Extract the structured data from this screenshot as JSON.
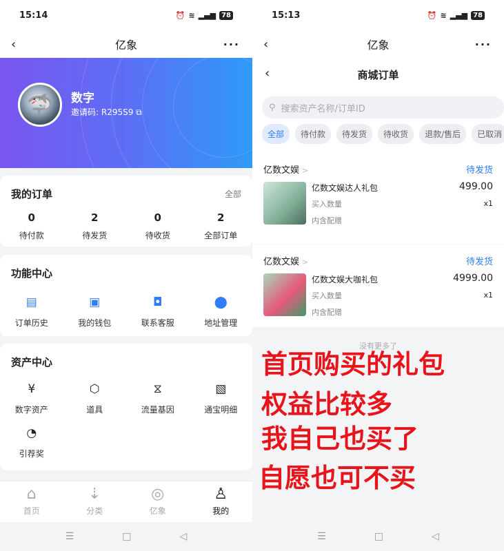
{
  "left": {
    "status": {
      "time": "15:14",
      "battery": "78"
    },
    "nav": {
      "title": "亿象",
      "back": "‹",
      "more": "···"
    },
    "profile": {
      "name": "数字",
      "invite": "邀请码: R295S9 ⧉"
    },
    "orders": {
      "title": "我的订单",
      "link": "全部",
      "items": [
        {
          "count": "0",
          "label": "待付款"
        },
        {
          "count": "2",
          "label": "待发货"
        },
        {
          "count": "0",
          "label": "待收货"
        },
        {
          "count": "2",
          "label": "全部订单"
        }
      ]
    },
    "functions": {
      "title": "功能中心",
      "items": [
        {
          "icon": "order-history-icon",
          "glyph": "▤",
          "label": "订单历史"
        },
        {
          "icon": "wallet-icon",
          "glyph": "▣",
          "label": "我的钱包"
        },
        {
          "icon": "customer-service-icon",
          "glyph": "◘",
          "label": "联系客服"
        },
        {
          "icon": "location-pin-icon",
          "glyph": "⬤",
          "label": "地址管理"
        }
      ]
    },
    "assets": {
      "title": "资产中心",
      "items": [
        {
          "icon": "yen-icon",
          "glyph": "¥",
          "label": "数字资产"
        },
        {
          "icon": "cube-icon",
          "glyph": "⬡",
          "label": "道具"
        },
        {
          "icon": "dna-icon",
          "glyph": "⧖",
          "label": "流量基因"
        },
        {
          "icon": "ledger-icon",
          "glyph": "▧",
          "label": "通宝明细"
        },
        {
          "icon": "referral-icon",
          "glyph": "◔",
          "label": "引荐奖"
        }
      ]
    },
    "tabs": [
      {
        "icon": "home-icon",
        "glyph": "⌂",
        "label": "首页"
      },
      {
        "icon": "category-icon",
        "glyph": "⇣",
        "label": "分类"
      },
      {
        "icon": "globe-icon",
        "glyph": "◎",
        "label": "亿象"
      },
      {
        "icon": "profile-icon",
        "glyph": "♙",
        "label": "我的"
      }
    ],
    "system": {
      "menu": "☰",
      "home": "□",
      "back": "◁"
    }
  },
  "right": {
    "status": {
      "time": "15:13",
      "battery": "78"
    },
    "nav": {
      "title": "亿象",
      "back": "‹",
      "more": "···"
    },
    "subnav": {
      "title": "商城订单",
      "back": "‹"
    },
    "search": {
      "placeholder": "搜索资产名称/订单ID",
      "icon": "⚲"
    },
    "filters": [
      "全部",
      "待付款",
      "待发货",
      "待收货",
      "退款/售后",
      "已取消"
    ],
    "orders": [
      {
        "shop": "亿数文娱",
        "chevron": ">",
        "status": "待发货",
        "product": "亿数文娱达人礼包",
        "price": "499.00",
        "qty_label": "买入数量",
        "qty": "x1",
        "config": "内含配赠"
      },
      {
        "shop": "亿数文娱",
        "chevron": ">",
        "status": "待发货",
        "product": "亿数文娱大咖礼包",
        "price": "4999.00",
        "qty_label": "买入数量",
        "qty": "x1",
        "config": "内含配赠"
      }
    ],
    "no_more": "没有更多了",
    "system": {
      "menu": "☰",
      "home": "□",
      "back": "◁"
    }
  },
  "overlay_text": [
    "首页购买的礼包",
    "权益比较多",
    "我自己也买了",
    "自愿也可不买"
  ],
  "colors": {
    "accent": "#2f7ef5",
    "overlay": "#e8141c",
    "gradient_start": "#7a55f0",
    "gradient_end": "#2f9af7"
  }
}
